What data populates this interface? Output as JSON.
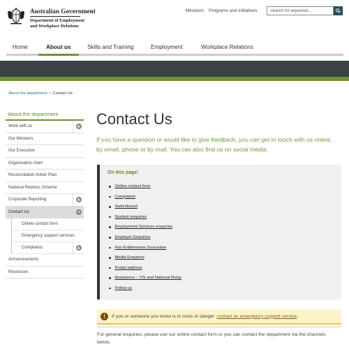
{
  "header": {
    "gov_title": "Australian Government",
    "dept_name": "Department of Employment and Workplace Relations",
    "utility_links": [
      "Ministers",
      "Programs and initiatives"
    ],
    "search_placeholder": "Search for keywords...",
    "crest_icon": "coat-of-arms-icon",
    "search_icon": "search-icon"
  },
  "nav": {
    "items": [
      "Home",
      "About us",
      "Skills and Training",
      "Employment",
      "Workplace Relations"
    ],
    "active": "About us",
    "accent": "#6f8f3a"
  },
  "breadcrumb": {
    "link": "About the department",
    "separator": "/",
    "current": "Contact Us"
  },
  "sidebar": {
    "heading": "About the department",
    "items": [
      {
        "label": "Work with us",
        "toggle": "plus"
      },
      {
        "label": "Our Ministers"
      },
      {
        "label": "Our Executive"
      },
      {
        "label": "Organisation chart"
      },
      {
        "label": "Reconciliation Action Plan"
      },
      {
        "label": "National Redress Scheme"
      },
      {
        "label": "Corporate Reporting",
        "toggle": "plus"
      },
      {
        "label": "Contact Us",
        "toggle": "minus",
        "active": true
      },
      {
        "label": "Announcements"
      },
      {
        "label": "Resources"
      }
    ],
    "sub_items": [
      {
        "label": "Online contact form"
      },
      {
        "label": "Emergency support services"
      },
      {
        "label": "Complaints",
        "toggle": "plus"
      }
    ]
  },
  "main": {
    "title": "Contact Us",
    "intro": "If you have a question or would like to give feedback, you can get in touch with us online, by email, phone or by mail. You can also find us on social media.",
    "on_this_page": {
      "title": "On this page:",
      "links": [
        "Online contact form",
        "Complaints",
        "Switchboard",
        "Student enquiries",
        "Employment Services enquiries",
        "Employer Enquiries",
        "Fair Entitlements Guarantee",
        "Media Enquiries",
        "Postal address",
        "Assistance – TIS and National Relay",
        "Follow us"
      ]
    },
    "alert": {
      "icon": "exclamation-icon",
      "text": "If you or someone you know is in crisis or danger",
      "link": "contact an emergency support service",
      "after": "."
    },
    "general": "For general enquiries, please use our online contact form or you can contact the department via the channels below."
  },
  "colors": {
    "green": "#6f8f3a",
    "banner_dark": "#3b4347",
    "alert_bg": "#fcf3c8"
  }
}
